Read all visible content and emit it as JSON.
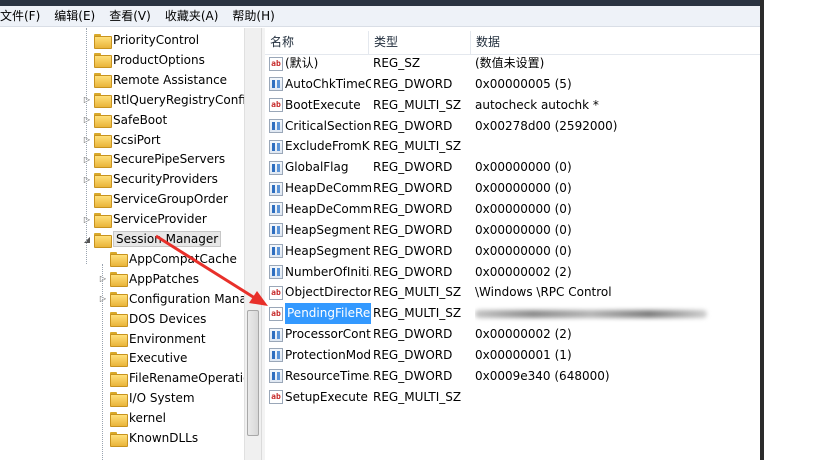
{
  "menu": [
    "文件(F)",
    "编辑(E)",
    "查看(V)",
    "收藏夹(A)",
    "帮助(H)"
  ],
  "tree": {
    "items": [
      {
        "label": "PriorityControl",
        "expander": ""
      },
      {
        "label": "ProductOptions",
        "expander": ""
      },
      {
        "label": "Remote Assistance",
        "expander": ""
      },
      {
        "label": "RtlQueryRegistryConfig",
        "expander": "▷"
      },
      {
        "label": "SafeBoot",
        "expander": "▷"
      },
      {
        "label": "ScsiPort",
        "expander": "▷"
      },
      {
        "label": "SecurePipeServers",
        "expander": "▷"
      },
      {
        "label": "SecurityProviders",
        "expander": "▷"
      },
      {
        "label": "ServiceGroupOrder",
        "expander": ""
      },
      {
        "label": "ServiceProvider",
        "expander": "▷"
      },
      {
        "label": "Session Manager",
        "expander": "◢"
      }
    ],
    "children": [
      {
        "label": "AppCompatCache",
        "expander": ""
      },
      {
        "label": "AppPatches",
        "expander": "▷"
      },
      {
        "label": "Configuration Manager",
        "expander": "▷"
      },
      {
        "label": "DOS Devices",
        "expander": ""
      },
      {
        "label": "Environment",
        "expander": ""
      },
      {
        "label": "Executive",
        "expander": ""
      },
      {
        "label": "FileRenameOperations",
        "expander": ""
      },
      {
        "label": "I/O System",
        "expander": ""
      },
      {
        "label": "kernel",
        "expander": ""
      },
      {
        "label": "KnownDLLs",
        "expander": ""
      }
    ]
  },
  "list": {
    "headers": {
      "name": "名称",
      "type": "类型",
      "data": "数据"
    },
    "rows": [
      {
        "icon": "ab",
        "name": "(默认)",
        "type": "REG_SZ",
        "data": "(数值未设置)"
      },
      {
        "icon": "bin",
        "name": "AutoChkTimeO...",
        "type": "REG_DWORD",
        "data": "0x00000005 (5)"
      },
      {
        "icon": "ab",
        "name": "BootExecute",
        "type": "REG_MULTI_SZ",
        "data": "autocheck autochk *"
      },
      {
        "icon": "bin",
        "name": "CriticalSection...",
        "type": "REG_DWORD",
        "data": "0x00278d00 (2592000)"
      },
      {
        "icon": "bin",
        "name": "ExcludeFromK...",
        "type": "REG_MULTI_SZ",
        "data": ""
      },
      {
        "icon": "bin",
        "name": "GlobalFlag",
        "type": "REG_DWORD",
        "data": "0x00000000 (0)"
      },
      {
        "icon": "bin",
        "name": "HeapDeComm...",
        "type": "REG_DWORD",
        "data": "0x00000000 (0)"
      },
      {
        "icon": "bin",
        "name": "HeapDeComm...",
        "type": "REG_DWORD",
        "data": "0x00000000 (0)"
      },
      {
        "icon": "bin",
        "name": "HeapSegment...",
        "type": "REG_DWORD",
        "data": "0x00000000 (0)"
      },
      {
        "icon": "bin",
        "name": "HeapSegment...",
        "type": "REG_DWORD",
        "data": "0x00000000 (0)"
      },
      {
        "icon": "bin",
        "name": "NumberOfIniti...",
        "type": "REG_DWORD",
        "data": "0x00000002 (2)"
      },
      {
        "icon": "ab",
        "name": "ObjectDirector...",
        "type": "REG_MULTI_SZ",
        "data": "\\Windows \\RPC Control"
      },
      {
        "icon": "ab",
        "name": "PendingFileRe...",
        "type": "REG_MULTI_SZ",
        "data": "",
        "selected": true,
        "blurred": true
      },
      {
        "icon": "bin",
        "name": "ProcessorCont...",
        "type": "REG_DWORD",
        "data": "0x00000002 (2)"
      },
      {
        "icon": "bin",
        "name": "ProtectionMode",
        "type": "REG_DWORD",
        "data": "0x00000001 (1)"
      },
      {
        "icon": "bin",
        "name": "ResourceTime...",
        "type": "REG_DWORD",
        "data": "0x0009e340 (648000)"
      },
      {
        "icon": "ab",
        "name": "SetupExecute",
        "type": "REG_MULTI_SZ",
        "data": ""
      }
    ]
  },
  "colors": {
    "selection": "#3399ff",
    "arrow": "#e8302a"
  }
}
